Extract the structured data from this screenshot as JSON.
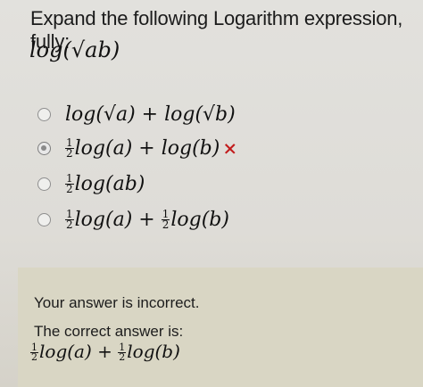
{
  "question": {
    "title": "Expand the following Logarithm expression, fully:",
    "expression": "log(√ab)"
  },
  "options": [
    {
      "parts": [
        "log(√a) + log(√b)"
      ],
      "selected": false,
      "marked_wrong": false
    },
    {
      "frac1": [
        "1",
        "2"
      ],
      "text1": "log(a) + log(b)",
      "selected": true,
      "marked_wrong": true,
      "mark": "×"
    },
    {
      "frac1": [
        "1",
        "2"
      ],
      "text1": "log(ab)",
      "selected": false,
      "marked_wrong": false
    },
    {
      "frac1": [
        "1",
        "2"
      ],
      "text1": "log(a) + ",
      "frac2": [
        "1",
        "2"
      ],
      "text2": "log(b)",
      "selected": false,
      "marked_wrong": false
    }
  ],
  "feedback": {
    "message": "Your answer is incorrect.",
    "correct_label": "The correct answer is:",
    "correct_frac1": [
      "1",
      "2"
    ],
    "correct_text1": "log(a) + ",
    "correct_frac2": [
      "1",
      "2"
    ],
    "correct_text2": "log(b)"
  },
  "colors": {
    "incorrect_mark": "#c21c1c",
    "feedback_background": "#d9d6c4"
  }
}
